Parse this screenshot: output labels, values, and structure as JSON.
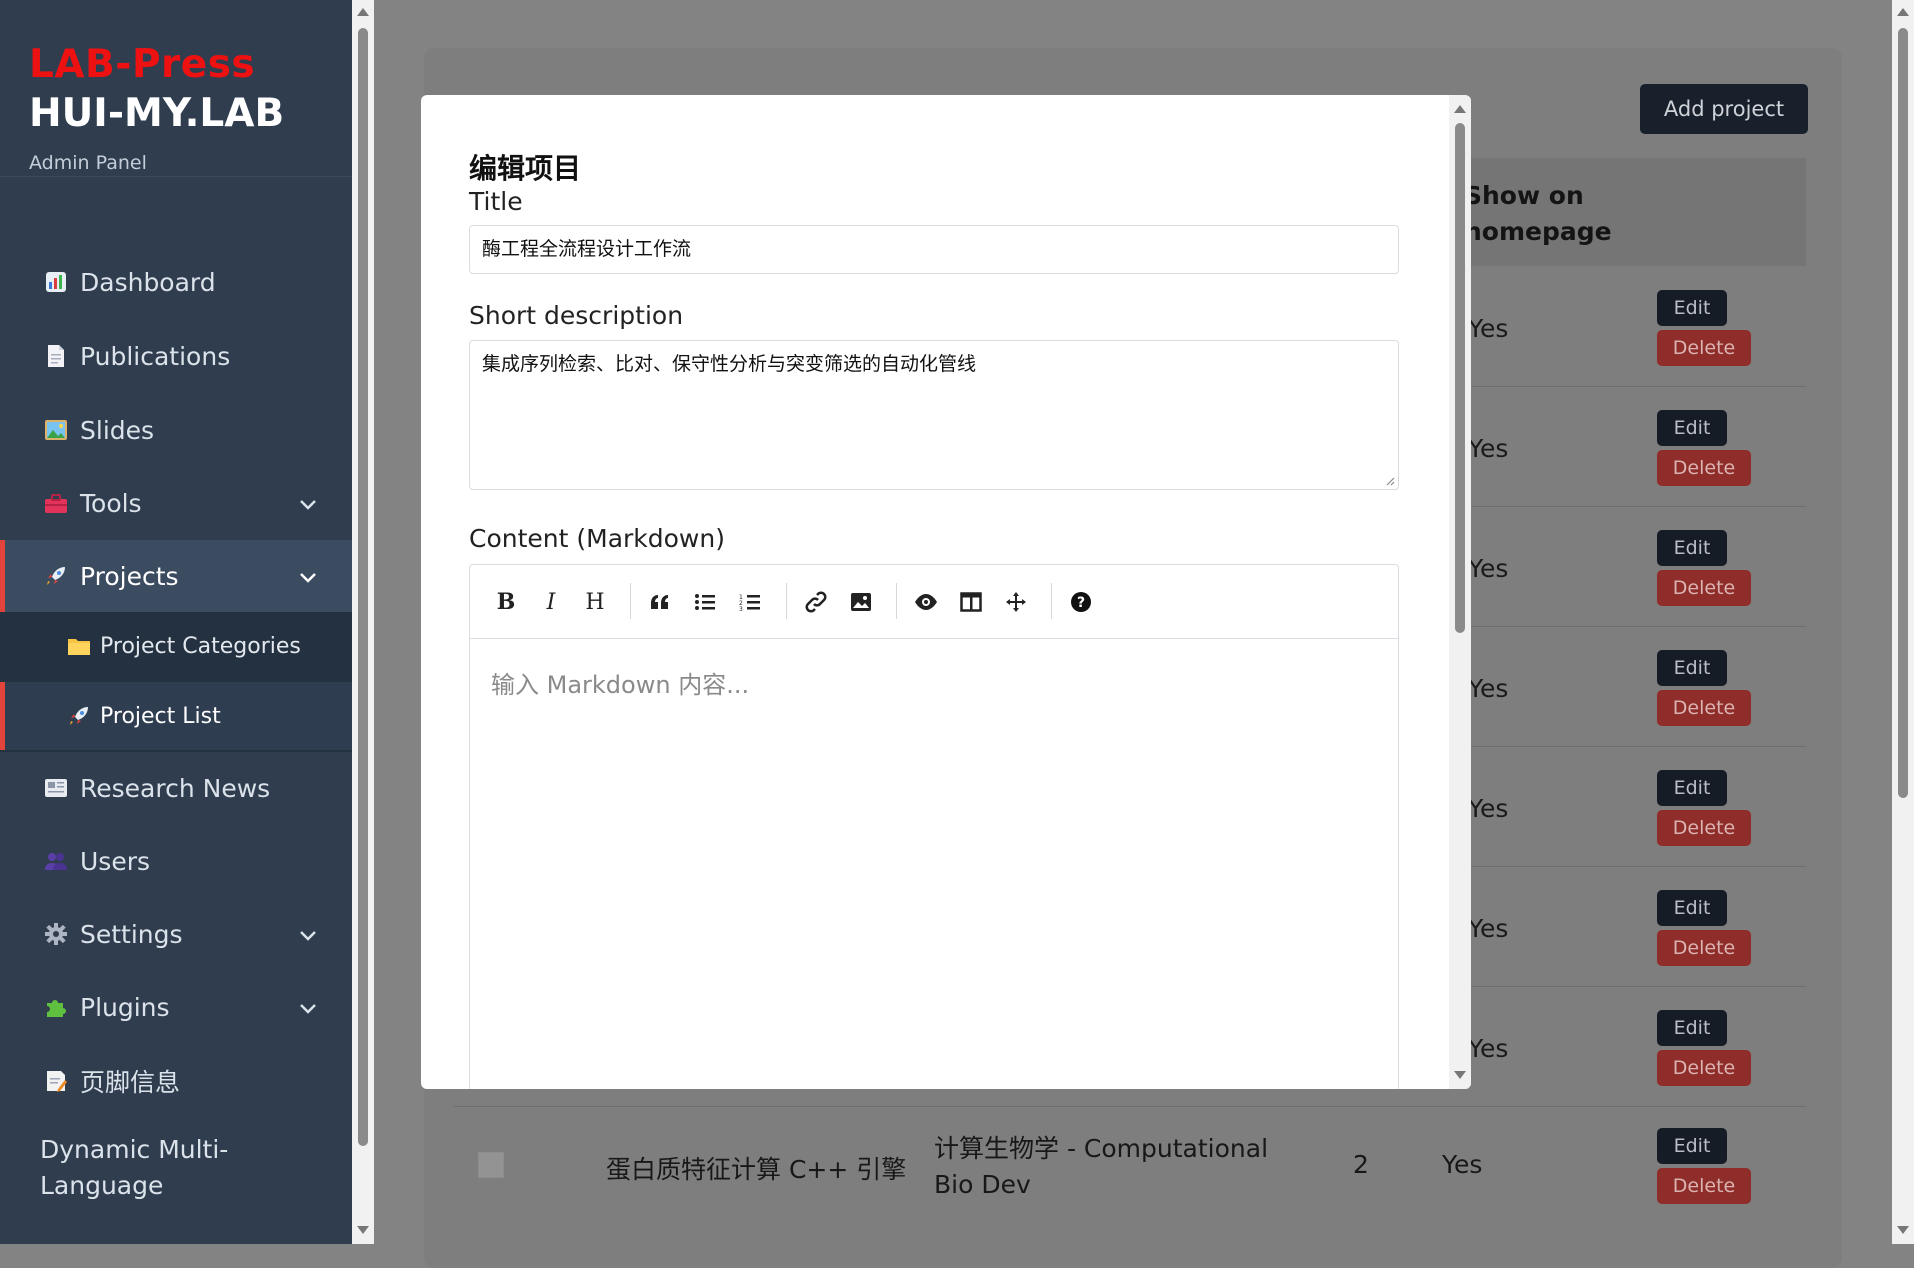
{
  "brand": {
    "lab": "LAB-Press",
    "site": "HUI-MY.LAB",
    "subtitle": "Admin Panel"
  },
  "sidebar": {
    "items": [
      {
        "label": "Dashboard",
        "icon": "chart-icon"
      },
      {
        "label": "Publications",
        "icon": "document-icon"
      },
      {
        "label": "Slides",
        "icon": "picture-icon"
      },
      {
        "label": "Tools",
        "icon": "toolbox-icon",
        "expandable": true
      },
      {
        "label": "Projects",
        "icon": "rocket-icon",
        "expandable": true,
        "active": true
      },
      {
        "label": "Research News",
        "icon": "newspaper-icon"
      },
      {
        "label": "Users",
        "icon": "users-icon"
      },
      {
        "label": "Settings",
        "icon": "gear-icon",
        "expandable": true
      },
      {
        "label": "Plugins",
        "icon": "puzzle-icon",
        "expandable": true
      },
      {
        "label": "页脚信息",
        "icon": "memo-icon"
      },
      {
        "label": "Dynamic Multi-Language"
      }
    ],
    "sub_items": [
      {
        "label": "Project Categories",
        "icon": "folder-icon"
      },
      {
        "label": "Project List",
        "icon": "rocket-icon",
        "active": true
      }
    ]
  },
  "background": {
    "add_button": "Add project",
    "column_header": "Show on homepage",
    "cell_yes": "Yes",
    "edit_label": "Edit",
    "delete_label": "Delete",
    "last_row": {
      "name": "蛋白质特征计算 C++ 引擎",
      "category": "计算生物学 - Computational Bio Dev",
      "count": "2",
      "show": "Yes"
    }
  },
  "modal": {
    "heading": "编辑项目",
    "title_label": "Title",
    "title_value": "酶工程全流程设计工作流",
    "desc_label": "Short description",
    "desc_value": "集成序列检索、比对、保守性分析与突变筛选的自动化管线",
    "content_label": "Content (Markdown)",
    "content_placeholder": "输入 Markdown 内容...",
    "toolbar": [
      "bold",
      "italic",
      "heading",
      "quote",
      "unordered-list",
      "ordered-list",
      "link",
      "image",
      "preview",
      "side-by-side",
      "fullscreen",
      "guide"
    ]
  },
  "colors": {
    "sidebar_bg": "#2f3d4f",
    "accent_red": "#ee1111",
    "active_border": "#e2433b",
    "edit_btn": "#18202c",
    "delete_btn": "#c0392b"
  }
}
